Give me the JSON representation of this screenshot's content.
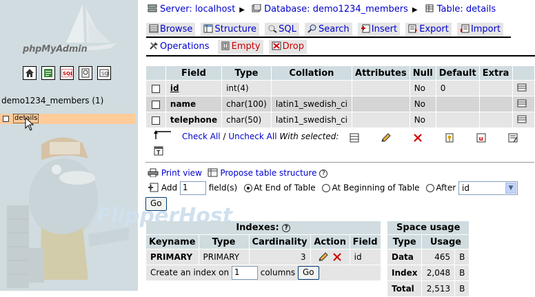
{
  "left": {
    "logo_text_a": "php",
    "logo_text_b": "MyAdmin",
    "icons": [
      "home-icon",
      "query-window-icon",
      "sql-icon",
      "docs-icon",
      "help-icon"
    ],
    "database": "demo1234_members (1)",
    "table": "details"
  },
  "breadcrumb": {
    "server_label": "Server:",
    "server": "localhost",
    "database_label": "Database:",
    "database": "demo1234_members",
    "table_label": "Table:",
    "table": "details",
    "separator": "▶"
  },
  "tabs": [
    {
      "label": "Browse"
    },
    {
      "label": "Structure"
    },
    {
      "label": "SQL"
    },
    {
      "label": "Search"
    },
    {
      "label": "Insert"
    },
    {
      "label": "Export"
    },
    {
      "label": "Import"
    }
  ],
  "tabs2": [
    {
      "label": "Operations"
    },
    {
      "label": "Empty"
    },
    {
      "label": "Drop"
    }
  ],
  "fields": {
    "headers": [
      "Field",
      "Type",
      "Collation",
      "Attributes",
      "Null",
      "Default",
      "Extra"
    ],
    "rows": [
      {
        "field": "id",
        "type": "int(4)",
        "collation": "",
        "attributes": "",
        "null": "No",
        "default": "0",
        "extra": ""
      },
      {
        "field": "name",
        "type": "char(100)",
        "collation": "latin1_swedish_ci",
        "attributes": "",
        "null": "No",
        "default": "",
        "extra": ""
      },
      {
        "field": "telephone",
        "type": "char(50)",
        "collation": "latin1_swedish_ci",
        "attributes": "",
        "null": "No",
        "default": "",
        "extra": ""
      }
    ]
  },
  "selection": {
    "check_all": "Check All",
    "slash": "/",
    "uncheck_all": "Uncheck All",
    "with_selected": "With selected:"
  },
  "actions": {
    "print_view": "Print view",
    "propose": "Propose table structure",
    "add_label": "Add",
    "add_value": "1",
    "fields_label": "field(s)",
    "end_label": "At End of Table",
    "begin_label": "At Beginning of Table",
    "after_label": "After",
    "after_value": "id",
    "go": "Go"
  },
  "watermark": "FlipperHost",
  "indexes": {
    "title": "Indexes:",
    "headers": [
      "Keyname",
      "Type",
      "Cardinality",
      "Action",
      "Field"
    ],
    "row": {
      "keyname": "PRIMARY",
      "type": "PRIMARY",
      "cardinality": "3",
      "field": "id"
    },
    "create_label": "Create an index on",
    "create_value": "1",
    "columns_label": "columns",
    "go": "Go"
  },
  "space": {
    "title": "Space usage",
    "headers": [
      "Type",
      "Usage"
    ],
    "rows": [
      {
        "type": "Data",
        "usage": "465",
        "unit": "B"
      },
      {
        "type": "Index",
        "usage": "2,048",
        "unit": "B"
      },
      {
        "type": "Total",
        "usage": "2,513",
        "unit": "B"
      }
    ]
  }
}
